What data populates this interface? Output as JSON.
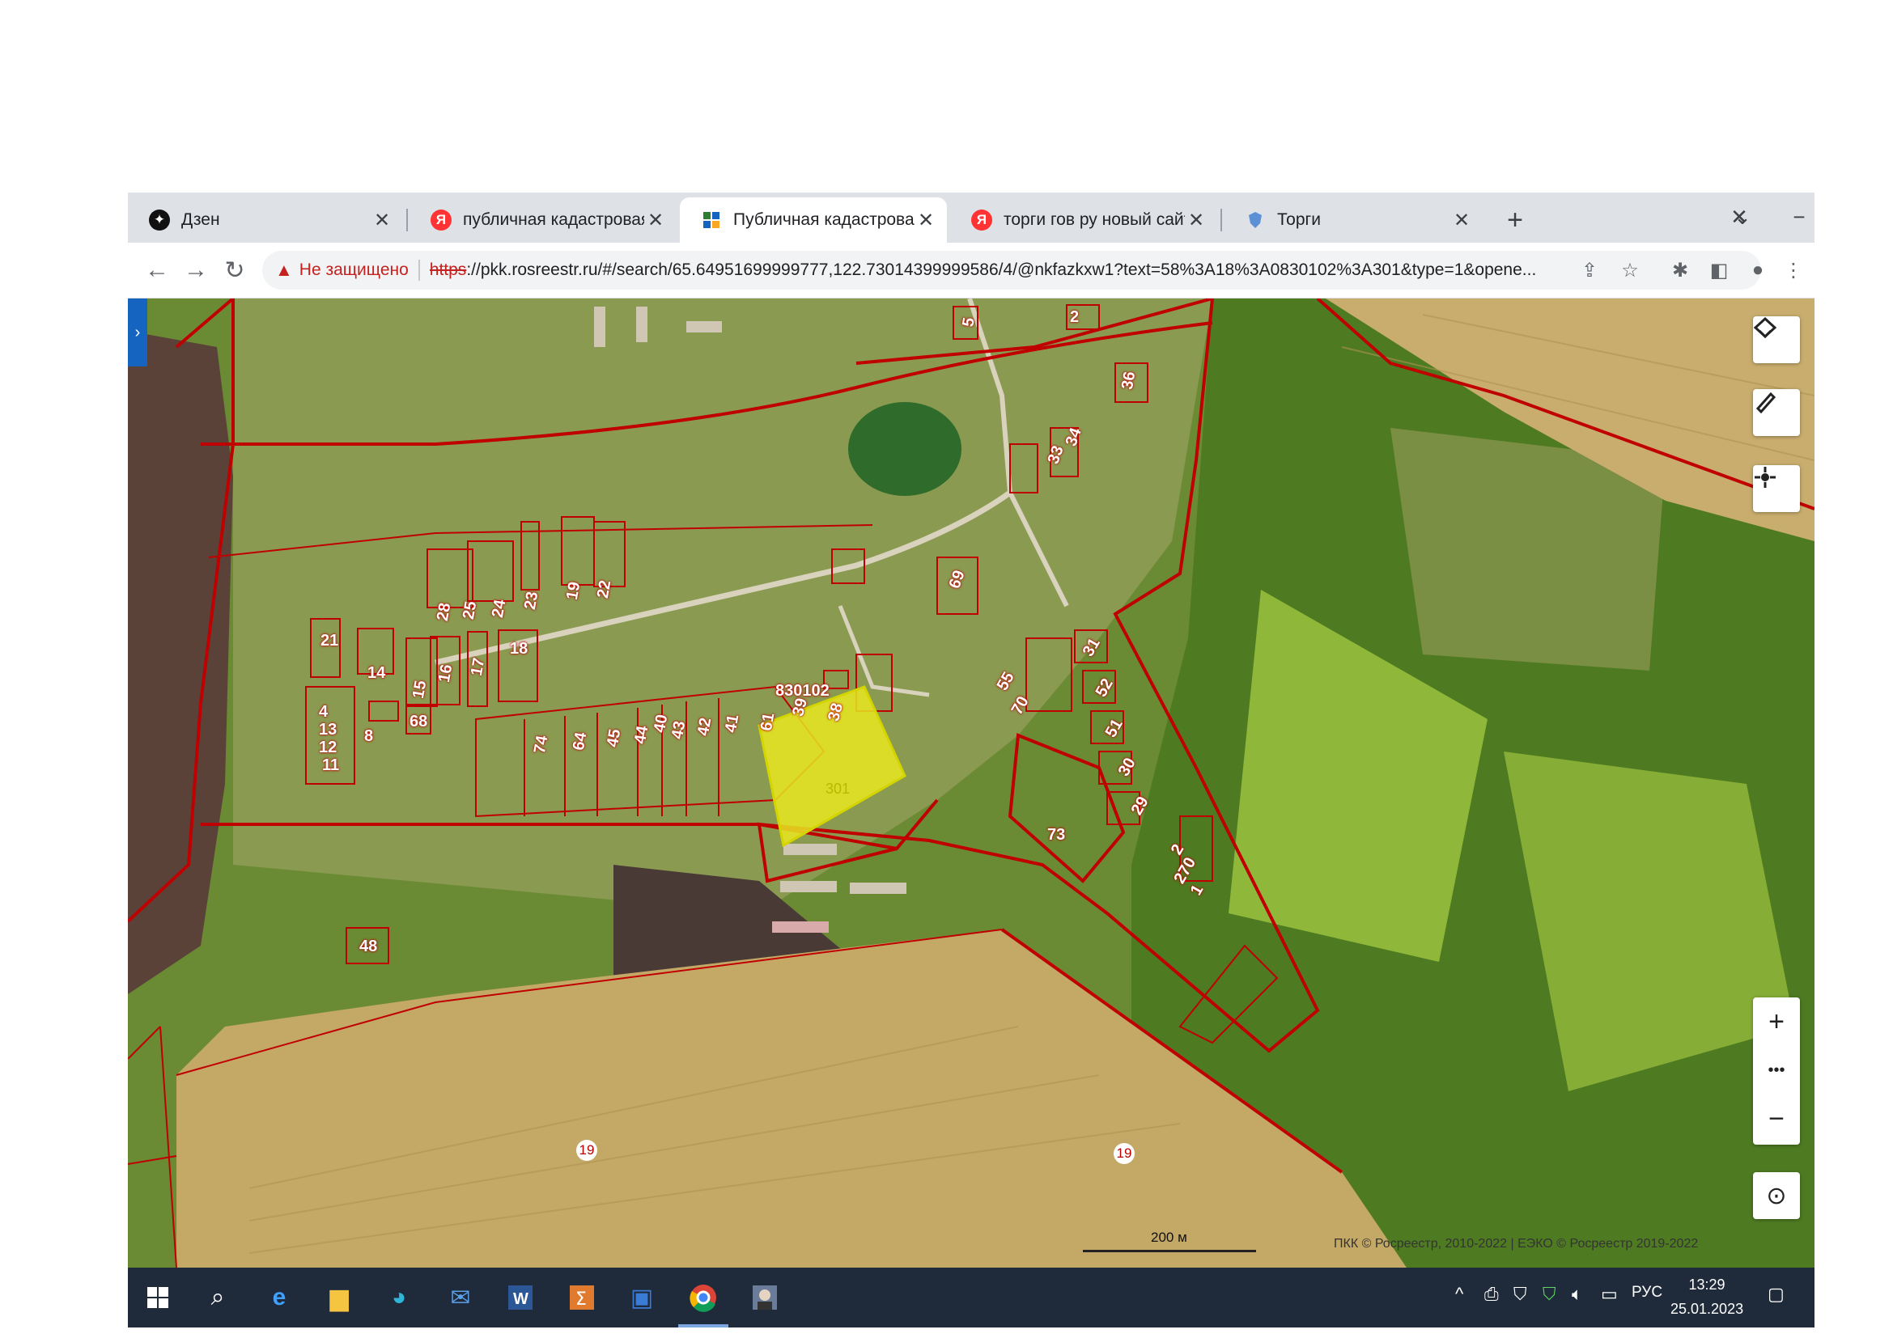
{
  "browser": {
    "tabs": [
      {
        "title": "Дзен",
        "favicon": "dzen-icon",
        "active": false
      },
      {
        "title": "публичная кадастровая кар",
        "favicon": "yandex-icon",
        "active": false
      },
      {
        "title": "Публичная кадастровая кар",
        "favicon": "pkk-icon",
        "active": true
      },
      {
        "title": "торги гов ру новый сайт —",
        "favicon": "yandex-icon",
        "active": false
      },
      {
        "title": "Торги",
        "favicon": "torgi-icon",
        "active": false
      }
    ],
    "close_glyph": "✕",
    "new_tab_glyph": "+",
    "security_label": "Не защищено",
    "url_scheme": "https",
    "url_rest": "://pkk.rosreestr.ru/#/search/65.64951699999777,122.73014399999586/4/@nkfazkxw1?text=58%3A18%3A0830102%3A301&type=1&opene..."
  },
  "map": {
    "block_label": "830102",
    "selected_parcel_label": "301",
    "parcel_labels": [
      "5",
      "2",
      "36",
      "34",
      "33",
      "69",
      "28",
      "25",
      "24",
      "23",
      "19",
      "22",
      "21",
      "14",
      "15",
      "16",
      "17",
      "18",
      "4",
      "13",
      "12",
      "11",
      "8",
      "68",
      "74",
      "64",
      "45",
      "44",
      "40",
      "43",
      "42",
      "41",
      "61",
      "39",
      "38",
      "55",
      "70",
      "31",
      "52",
      "51",
      "30",
      "29",
      "73",
      "2",
      "270",
      "1",
      "48"
    ],
    "field_labels": [
      "19",
      "19"
    ],
    "scale_label": "200 м",
    "copyright": "ПКК © Росреестр, 2010-2022 | ЕЭКО © Росреестр 2019-2022",
    "controls": [
      "layers-icon",
      "ruler-icon",
      "locate-icon"
    ],
    "zoom_in": "+",
    "zoom_more": "•••",
    "zoom_out": "−",
    "compass": "⊙",
    "colors": {
      "parcel_border": "#c00000",
      "selected_fill": "#e8e820",
      "field": "#b9a060"
    }
  },
  "taskbar": {
    "language": "РУС",
    "time": "13:29",
    "date": "25.01.2023"
  }
}
